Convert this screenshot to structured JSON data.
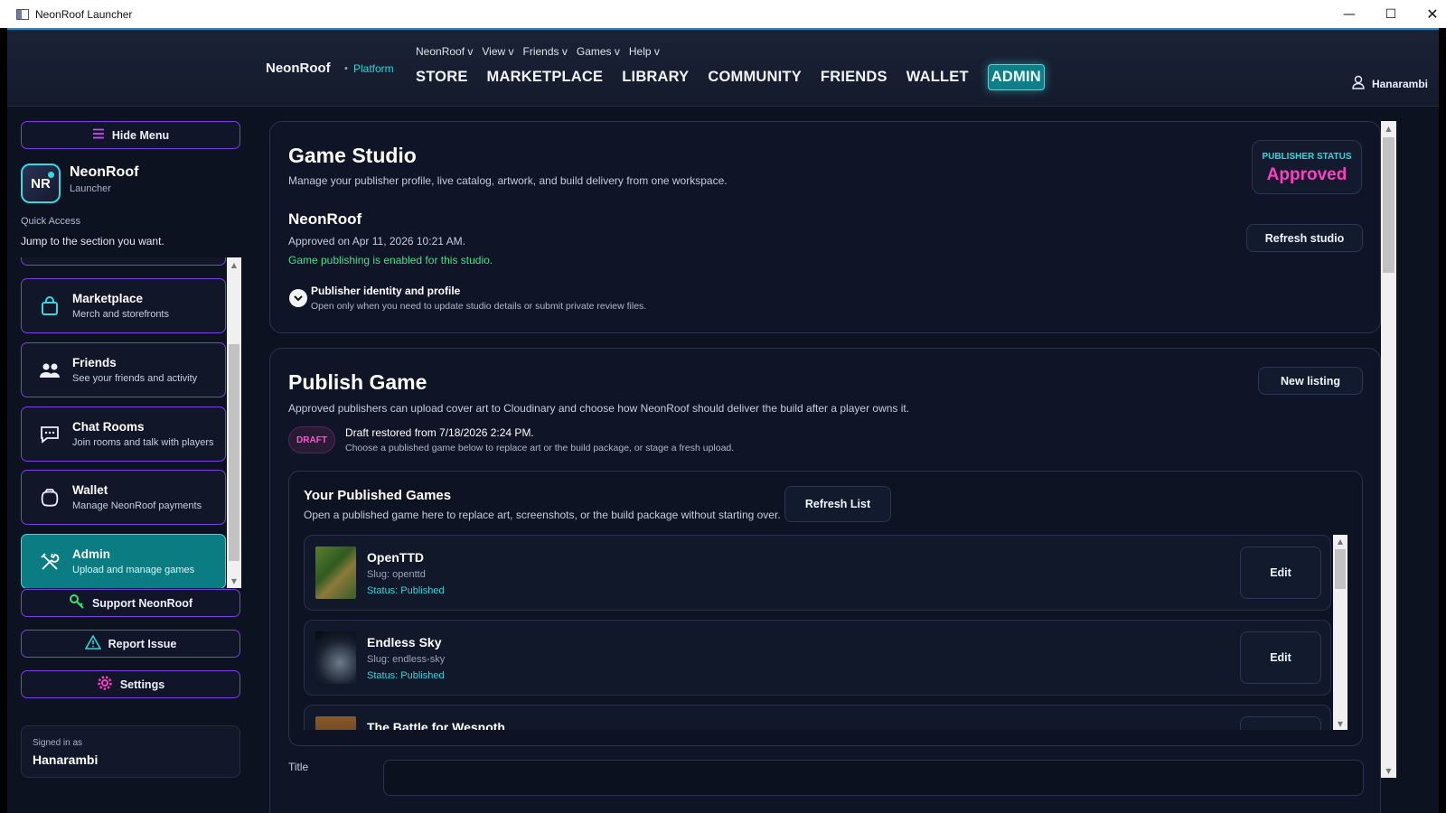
{
  "window": {
    "title": "NeonRoof Launcher"
  },
  "header": {
    "brand": "NeonRoof",
    "brand_sub": "Platform",
    "menus": [
      "NeonRoof v",
      "View v",
      "Friends v",
      "Games v",
      "Help v"
    ],
    "nav": [
      "STORE",
      "MARKETPLACE",
      "LIBRARY",
      "COMMUNITY",
      "FRIENDS",
      "WALLET",
      "ADMIN"
    ],
    "active_nav": "ADMIN",
    "user": "Hanarambi"
  },
  "sidebar": {
    "hide_menu": "Hide Menu",
    "app_initials": "NR",
    "app_name": "NeonRoof",
    "app_sub": "Launcher",
    "quick_access_title": "Quick Access",
    "quick_access_desc": "Jump to the section you want.",
    "items": [
      {
        "title": "Marketplace",
        "desc": "Merch and storefronts",
        "icon": "shopping-bag-icon"
      },
      {
        "title": "Friends",
        "desc": "See your friends and activity",
        "icon": "friends-icon"
      },
      {
        "title": "Chat Rooms",
        "desc": "Join rooms and talk with players",
        "icon": "chat-icon"
      },
      {
        "title": "Wallet",
        "desc": "Manage NeonRoof payments",
        "icon": "wallet-icon"
      },
      {
        "title": "Admin",
        "desc": "Upload and manage games",
        "icon": "tools-icon"
      }
    ],
    "support": "Support NeonRoof",
    "report": "Report Issue",
    "settings": "Settings",
    "signed_in_label": "Signed in as",
    "signed_in_user": "Hanarambi"
  },
  "studio": {
    "title": "Game Studio",
    "desc": "Manage your publisher profile, live catalog, artwork, and build delivery from one workspace.",
    "status_label": "PUBLISHER STATUS",
    "status_value": "Approved",
    "name": "NeonRoof",
    "approved_on": "Approved on Apr 11, 2026 10:21 AM.",
    "publishing_enabled": "Game publishing is enabled for this studio.",
    "refresh": "Refresh studio",
    "identity_title": "Publisher identity and profile",
    "identity_desc": "Open only when you need to update studio details or submit private review files."
  },
  "publish": {
    "title": "Publish Game",
    "desc": "Approved publishers can upload cover art to Cloudinary and choose how NeonRoof should deliver the build after a player owns it.",
    "new_listing": "New listing",
    "draft_badge": "DRAFT",
    "draft_title": "Draft restored from 7/18/2026 2:24 PM.",
    "draft_desc": "Choose a published game below to replace art or the build package, or stage a fresh upload.",
    "published_title": "Your Published Games",
    "published_desc": "Open a published game here to replace art, screenshots, or the build package without starting over.",
    "refresh_list": "Refresh List",
    "games": [
      {
        "name": "OpenTTD",
        "slug": "Slug: openttd",
        "status": "Status: Published",
        "edit": "Edit"
      },
      {
        "name": "Endless Sky",
        "slug": "Slug: endless-sky",
        "status": "Status: Published",
        "edit": "Edit"
      },
      {
        "name": "The Battle for Wesnoth",
        "slug": "",
        "status": "",
        "edit": ""
      }
    ],
    "title_field_label": "Title"
  }
}
